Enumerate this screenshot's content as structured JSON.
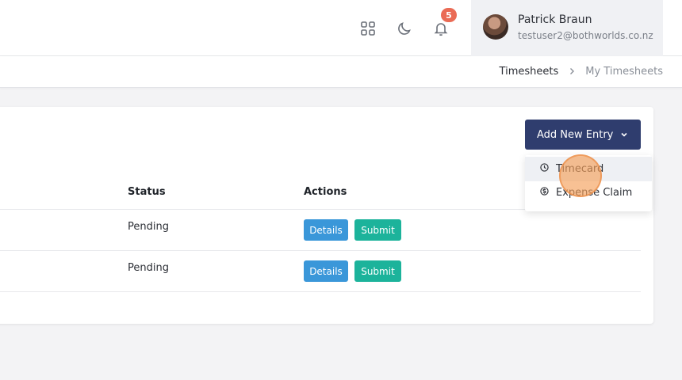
{
  "header": {
    "notification_count": "5",
    "user": {
      "name": "Patrick Braun",
      "email": "testuser2@bothworlds.co.nz"
    },
    "icons": [
      "apps-grid-icon",
      "moon-icon",
      "bell-icon"
    ]
  },
  "breadcrumb": {
    "items": [
      "Timesheets",
      "My Timesheets"
    ]
  },
  "toolbar": {
    "add_entry_label": "Add New Entry"
  },
  "dropdown": {
    "items": [
      {
        "label": "Timecard",
        "icon": "clock-icon"
      },
      {
        "label": "Expense Claim",
        "icon": "dollar-circle-icon"
      }
    ]
  },
  "table": {
    "columns": [
      "Status",
      "Actions"
    ],
    "rows": [
      {
        "status": "Pending",
        "details_label": "Details",
        "submit_label": "Submit"
      },
      {
        "status": "Pending",
        "details_label": "Details",
        "submit_label": "Submit"
      }
    ]
  },
  "colors": {
    "primary": "#2f3d6e",
    "details": "#3a97d9",
    "submit": "#1cb39b",
    "badge": "#ea6b55"
  }
}
